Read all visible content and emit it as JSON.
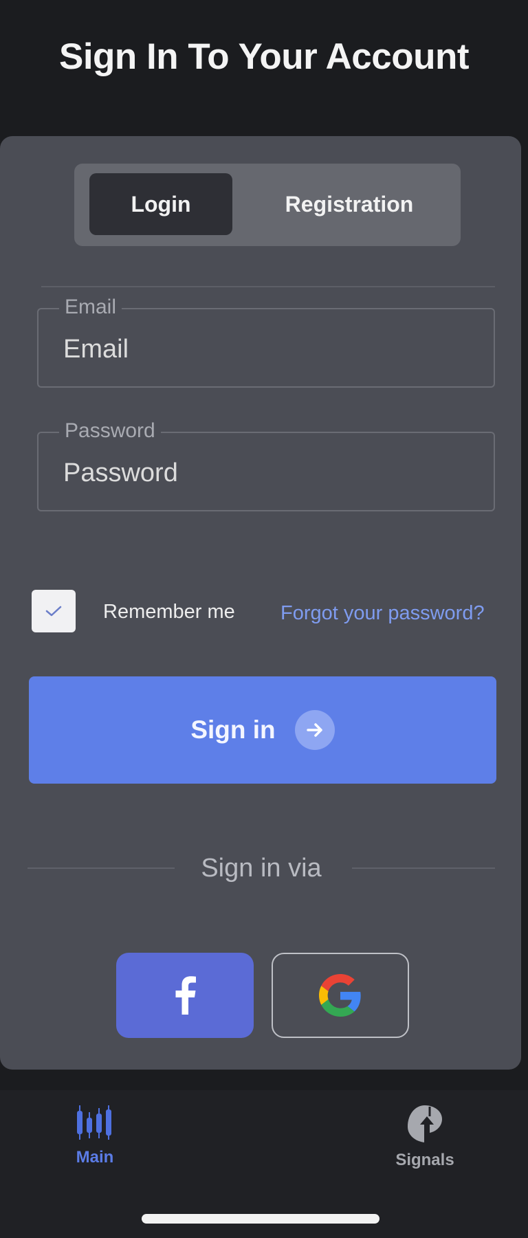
{
  "page": {
    "title": "Sign In To Your Account"
  },
  "tabs": {
    "login": "Login",
    "registration": "Registration",
    "active": "login"
  },
  "form": {
    "email": {
      "label": "Email",
      "placeholder": "Email",
      "value": ""
    },
    "password": {
      "label": "Password",
      "placeholder": "Password",
      "value": ""
    },
    "remember_me": {
      "label": "Remember me",
      "checked": true
    },
    "forgot_password": "Forgot your password?",
    "submit": "Sign in"
  },
  "social": {
    "divider_text": "Sign in via",
    "providers": [
      "facebook-icon",
      "google-icon"
    ]
  },
  "bottom_nav": {
    "items": [
      {
        "label": "Main",
        "icon": "candlestick-chart-icon",
        "active": true
      },
      {
        "label": "Signals",
        "icon": "signals-icon",
        "active": false
      }
    ]
  },
  "colors": {
    "accent": "#5e7fe8",
    "link": "#7f9cf0",
    "facebook": "#5b6bd6",
    "card": "#4b4d55",
    "background": "#1b1c1f"
  }
}
